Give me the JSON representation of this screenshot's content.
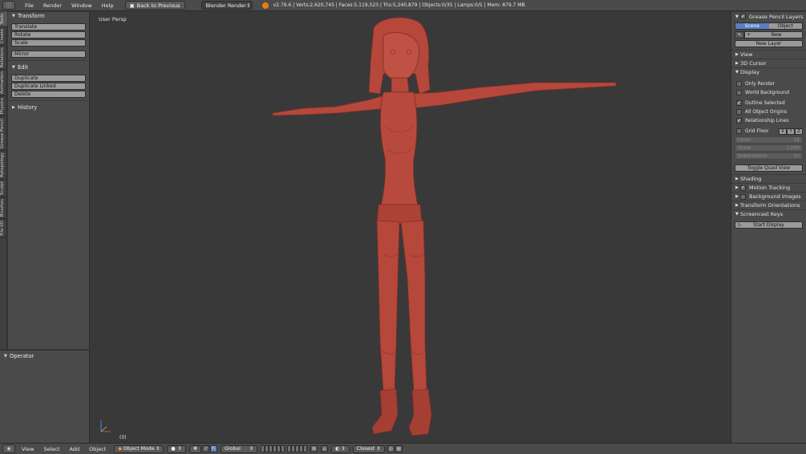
{
  "topbar": {
    "menus": [
      "File",
      "Render",
      "Window",
      "Help"
    ],
    "back_label": "Back to Previous",
    "render_engine": "Blender Render",
    "stats": "v2.79.6 | Verts:2,620,745 | Faces:5,119,523 | Tris:5,240,879 | Objects:0/35 | Lamps:0/5 | Mem: 879.7 MB"
  },
  "tabs": [
    "Tools",
    "Create",
    "Relations",
    "Animation",
    "Physics",
    "Grease Pencil",
    "Retopology",
    "Sculpt",
    "Brushes",
    "File I/O"
  ],
  "toolshelf": {
    "transform": {
      "title": "Transform",
      "buttons": [
        "Translate",
        "Rotate",
        "Scale",
        "Mirror"
      ]
    },
    "edit": {
      "title": "Edit",
      "buttons": [
        "Duplicate",
        "Duplicate Linked",
        "Delete"
      ]
    },
    "history": {
      "title": "History"
    }
  },
  "operator": {
    "title": "Operator"
  },
  "viewport": {
    "view_name": "User Persp",
    "frame": "(0)"
  },
  "props": {
    "grease_pencil": {
      "title": "Grease Pencil Layers",
      "scene": "Scene",
      "object": "Object",
      "new": "New",
      "new_layer": "New Layer"
    },
    "view": "View",
    "cursor": "3D Cursor",
    "display": {
      "title": "Display",
      "only_render": "Only Render",
      "world_background": "World Background",
      "outline_selected": "Outline Selected",
      "all_object_origins": "All Object Origins",
      "relationship_lines": "Relationship Lines",
      "grid_floor": "Grid Floor",
      "x": "X",
      "y": "Y",
      "z": "Z",
      "lines_label": "Lines:",
      "lines_value": "16",
      "scale_label": "Scale:",
      "scale_value": "1.000",
      "subdiv_label": "Subdivisions:",
      "subdiv_value": "10",
      "toggle_quad": "Toggle Quad View"
    },
    "shading": "Shading",
    "motion_tracking": "Motion Tracking",
    "background_images": "Background Images",
    "transform_orientations": "Transform Orientations",
    "screencast": {
      "title": "Screencast Keys",
      "start": "Start Display"
    }
  },
  "bottombar": {
    "menus": [
      "View",
      "Select",
      "Add",
      "Object"
    ],
    "mode": "Object Mode",
    "orientation": "Global",
    "snap": "Closest"
  },
  "colors": {
    "model": "#b5483b",
    "accent": "#5680c2",
    "logo": "#e87d0d"
  }
}
